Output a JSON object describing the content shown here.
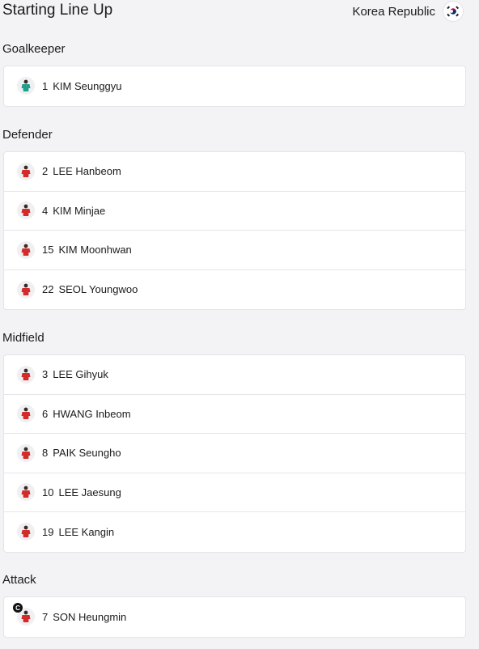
{
  "header": {
    "title": "Starting Line Up",
    "team_name": "Korea Republic",
    "flag_icon": "korea-flag-icon"
  },
  "colors": {
    "outfield_kit": "#d42a2a",
    "goalkeeper_kit": "#1fa08c",
    "background": "#f3f3f5"
  },
  "sections": [
    {
      "title": "Goalkeeper",
      "players": [
        {
          "number": "1",
          "name": "KIM Seunggyu",
          "kit": "goalkeeper"
        }
      ]
    },
    {
      "title": "Defender",
      "players": [
        {
          "number": "2",
          "name": "LEE Hanbeom",
          "kit": "outfield"
        },
        {
          "number": "4",
          "name": "KIM Minjae",
          "kit": "outfield"
        },
        {
          "number": "15",
          "name": "KIM Moonhwan",
          "kit": "outfield"
        },
        {
          "number": "22",
          "name": "SEOL Youngwoo",
          "kit": "outfield"
        }
      ]
    },
    {
      "title": "Midfield",
      "players": [
        {
          "number": "3",
          "name": "LEE Gihyuk",
          "kit": "outfield"
        },
        {
          "number": "6",
          "name": "HWANG Inbeom",
          "kit": "outfield"
        },
        {
          "number": "8",
          "name": "PAIK Seungho",
          "kit": "outfield"
        },
        {
          "number": "10",
          "name": "LEE Jaesung",
          "kit": "outfield"
        },
        {
          "number": "19",
          "name": "LEE Kangin",
          "kit": "outfield"
        }
      ]
    },
    {
      "title": "Attack",
      "players": [
        {
          "number": "7",
          "name": "SON Heungmin",
          "kit": "outfield",
          "captain_badge": "C"
        }
      ]
    }
  ]
}
